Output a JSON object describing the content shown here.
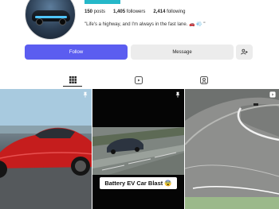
{
  "profile": {
    "stats": {
      "posts_count": "150",
      "posts_label": "posts",
      "followers_count": "1,405",
      "followers_label": "followers",
      "following_count": "2,414",
      "following_label": "following"
    },
    "bio": "\"Life's a highway, and I'm always in the fast lane. 🚗 💨 \"",
    "accent_color": "#25b8c9"
  },
  "actions": {
    "follow_label": "Follow",
    "message_label": "Message",
    "follow_color": "#5b5df0"
  },
  "tabs": [
    {
      "icon": "grid-icon",
      "active": true
    },
    {
      "icon": "reels-icon",
      "active": false
    },
    {
      "icon": "tagged-icon",
      "active": false
    }
  ],
  "posts": [
    {
      "thumbnail": "red sports car",
      "icon": "pin-icon"
    },
    {
      "thumbnail": "car on road",
      "overlay_text": "Battery EV Car Blast 😨",
      "icon": "pin-icon"
    },
    {
      "thumbnail": "race track aerial",
      "icon": "reel-icon"
    }
  ]
}
